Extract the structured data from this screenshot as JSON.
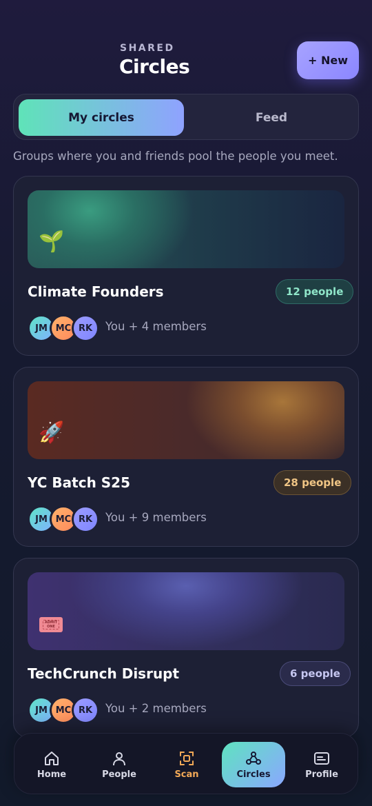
{
  "header": {
    "eyebrow": "SHARED",
    "title": "Circles",
    "new_button_label": "+ New"
  },
  "segments": [
    {
      "label": "My circles",
      "active": true
    },
    {
      "label": "Feed",
      "active": false
    }
  ],
  "subtitle": "Groups where you and friends pool the people you meet.",
  "circles": [
    {
      "name": "Climate Founders",
      "emoji": "🌱",
      "people": "12 people",
      "avatars": [
        "JM",
        "MC",
        "RK"
      ],
      "members": "You + 4 members",
      "accent": "#3ba88a"
    },
    {
      "name": "YC Batch S25",
      "emoji": "🚀",
      "people": "28 people",
      "avatars": [
        "JM",
        "MC",
        "RK"
      ],
      "members": "You + 9 members",
      "accent": "#c58a3e"
    },
    {
      "name": "TechCrunch Disrupt",
      "emoji": "🎟️",
      "ticket_text": "ADMIT ONE",
      "people": "6 people",
      "avatars": [
        "JM",
        "MC",
        "RK"
      ],
      "members": "You + 2 members",
      "accent": "#6b6ccf"
    }
  ],
  "tabbar": {
    "items": [
      {
        "label": "Home",
        "icon": "home-icon"
      },
      {
        "label": "People",
        "icon": "person-icon"
      },
      {
        "label": "Scan",
        "icon": "scan-icon"
      },
      {
        "label": "Circles",
        "icon": "circles-icon",
        "active": true
      },
      {
        "label": "Profile",
        "icon": "profile-card-icon"
      }
    ]
  }
}
